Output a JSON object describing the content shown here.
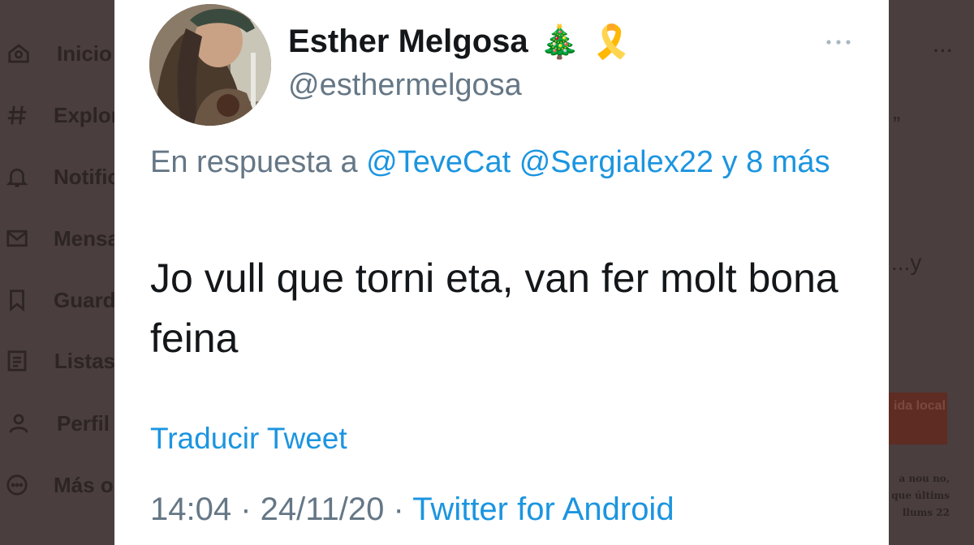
{
  "background": {
    "nav": [
      {
        "label": "Inicio",
        "icon": "home-icon"
      },
      {
        "label": "Explorar",
        "icon": "hashtag-icon"
      },
      {
        "label": "Notificaciones",
        "icon": "bell-icon"
      },
      {
        "label": "Mensajes",
        "icon": "mail-icon"
      },
      {
        "label": "Guardados",
        "icon": "bookmark-icon"
      },
      {
        "label": "Listas",
        "icon": "list-icon"
      },
      {
        "label": "Perfil",
        "icon": "user-icon"
      },
      {
        "label": "Más opciones",
        "icon": "more-circle-icon"
      }
    ],
    "right_dots": "···",
    "right_quote": "”",
    "right_ellipsis": "...y",
    "promo_text": "ida local",
    "article_text": "a nou no, que últims llums 22"
  },
  "tweet": {
    "display_name": "Esther Melgosa",
    "emoji_1": "🎄",
    "emoji_2": "🎗️",
    "handle": "@esthermelgosa",
    "reply_prefix": "En respuesta a",
    "reply_mentions": "@TeveCat @Sergialex22 y 8 más",
    "text": "Jo vull que torni eta, van fer molt bona feina",
    "translate_label": "Traducir Tweet",
    "timestamp": "14:04 · 24/11/20 ·",
    "source": "Twitter for Android"
  },
  "colors": {
    "link": "#1b95e0",
    "secondary_text": "#657786",
    "primary_text": "#14171a",
    "overlay": "#4a3e3e"
  }
}
